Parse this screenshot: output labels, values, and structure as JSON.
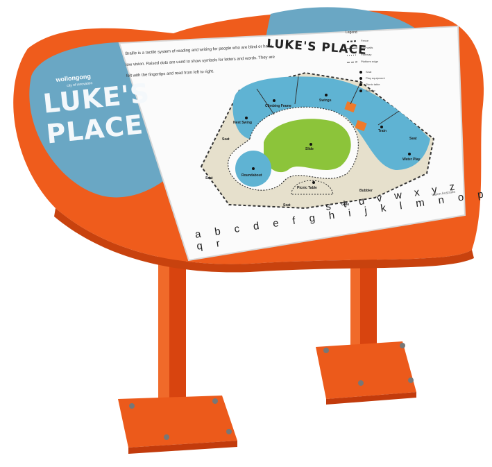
{
  "sign": {
    "brand_name": "wollongong",
    "brand_tagline": "city of innovation",
    "title_line1": "LUKE'S",
    "title_line2": "PLACE"
  },
  "board": {
    "map_title": "LUKE'S PLACE",
    "braille_description": "Braille is a tactile system of reading and writing for people who are blind or have low vision. Raised dots are used to show symbols for letters and words. They are felt with the fingertips and read from left to right.",
    "legend": {
      "title": "Legend",
      "items": [
        "Fence",
        "Low walls",
        "Pathway",
        "Platform edge",
        "Seat",
        "Play equipment",
        "Picnic table",
        "Bubbler"
      ]
    },
    "areas": {
      "climbing_frame": "Climbing Frame",
      "swings": "Swings",
      "nest_swing": "Nest Swing",
      "train": "Train",
      "slide": "Slide",
      "seat_top": "Seat",
      "seat_left": "Seat",
      "seat_right": "Seat",
      "seat_bottom": "Seat",
      "water_play": "Water Play",
      "roundabout": "Roundabout",
      "picnic_table": "Picnic Table",
      "bubbler": "Bubbler",
      "gate": "Gate"
    },
    "alphabet_line1": "a b c d e f g h i j k l m n o p q r",
    "alphabet_line2": "s t u v w x y z",
    "partner_logo": "Vision Australia"
  },
  "colors": {
    "orange": "#f0601f",
    "blue": "#6aa7c4",
    "map_blue": "#5fb3d3",
    "map_green": "#8cc43a",
    "map_beige": "#e6e0cc",
    "board_white": "#fbfbfb"
  }
}
